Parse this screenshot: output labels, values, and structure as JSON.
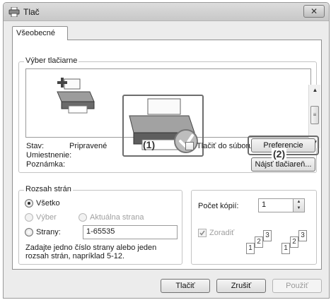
{
  "window": {
    "title": "Tlač",
    "close_label": "✕"
  },
  "tabs": [
    {
      "label": "Všeobecné"
    }
  ],
  "printer_section": {
    "group_label": "Výber tlačiarne",
    "status_label": "Stav:",
    "status_value": "Pripravené",
    "location_label": "Umiestnenie:",
    "comment_label": "Poznámka:",
    "print_to_file_label": "Tlačiť do súboru",
    "preferences_button": "Preferencie",
    "find_printer_button": "Nájsť tlačiareň...",
    "callout_1": "(1)",
    "callout_2": "(2)"
  },
  "page_range": {
    "group_label": "Rozsah strán",
    "all_label": "Všetko",
    "selection_label": "Výber",
    "current_page_label": "Aktuálna strana",
    "pages_label": "Strany:",
    "pages_value": "1-65535",
    "hint": "Zadajte jedno číslo strany alebo jeden rozsah strán, napríklad 5-12."
  },
  "copies": {
    "label": "Počet kópií:",
    "value": "1",
    "collate_label": "Zoradiť"
  },
  "footer": {
    "print_button": "Tlačiť",
    "cancel_button": "Zrušiť",
    "apply_button": "Použiť"
  }
}
